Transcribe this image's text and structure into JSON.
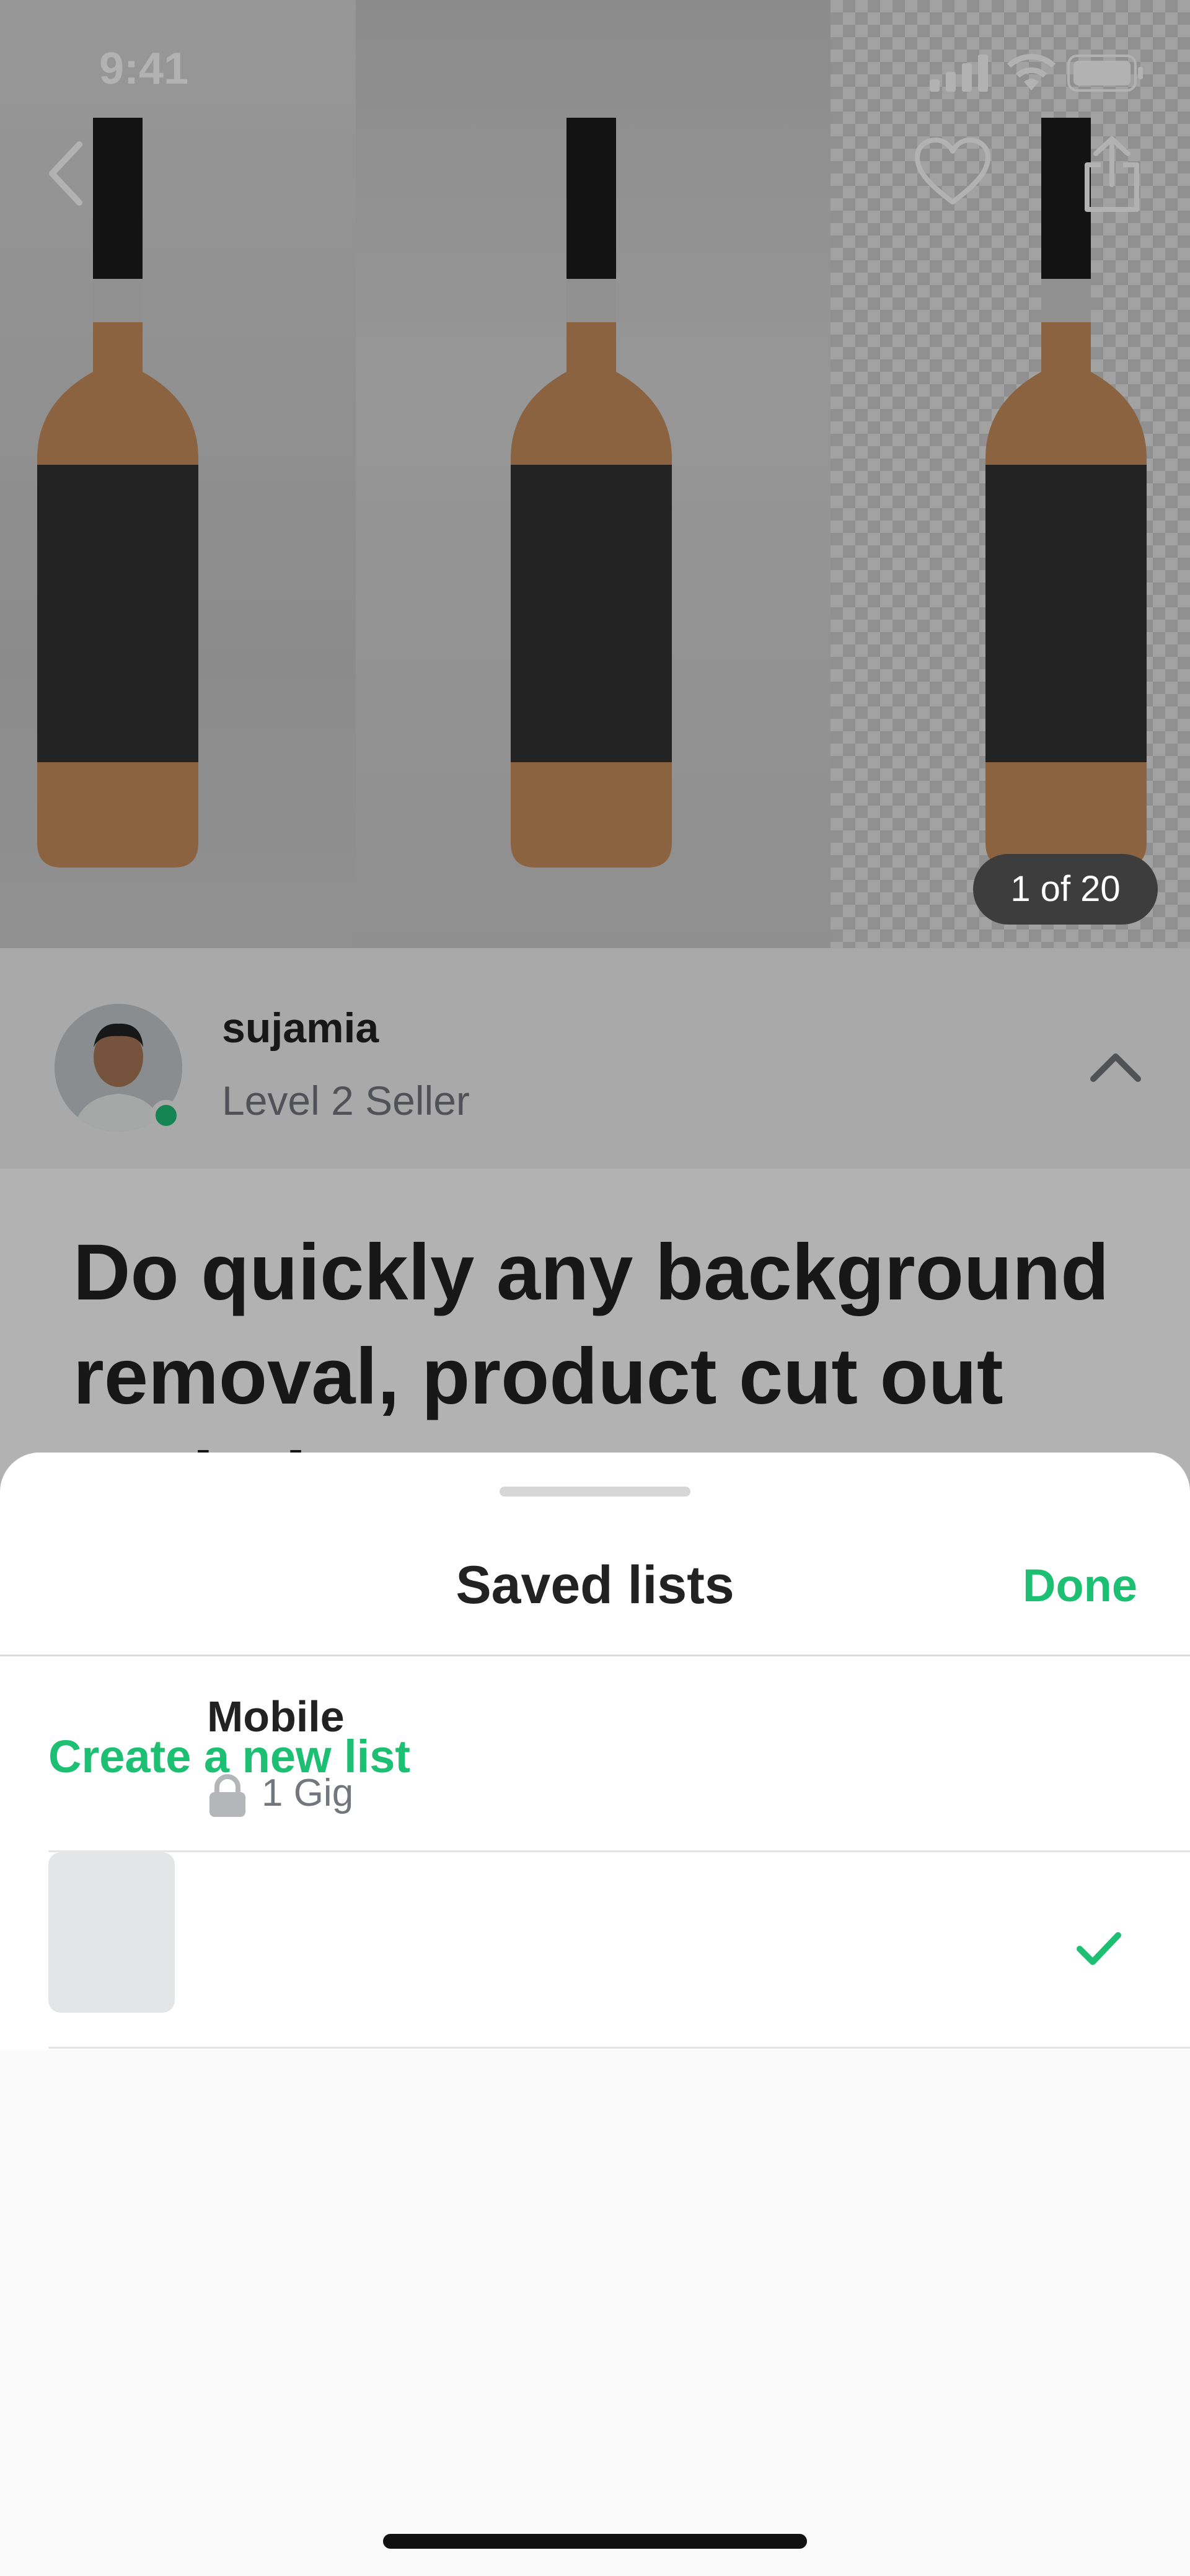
{
  "status_bar": {
    "time": "9:41"
  },
  "gallery": {
    "counter": "1 of 20"
  },
  "seller": {
    "name": "sujamia",
    "level": "Level 2 Seller"
  },
  "gig": {
    "title": "Do quickly any background removal, product cut out and photo cutout"
  },
  "sheet": {
    "title": "Saved lists",
    "done_label": "Done",
    "create_label": "Create a new list",
    "lists": [
      {
        "name": "Mobile",
        "count": "1 Gig",
        "selected": true
      }
    ]
  },
  "colors": {
    "accent": "#1dbf73",
    "text_primary": "#222222",
    "text_secondary": "#74767e"
  }
}
